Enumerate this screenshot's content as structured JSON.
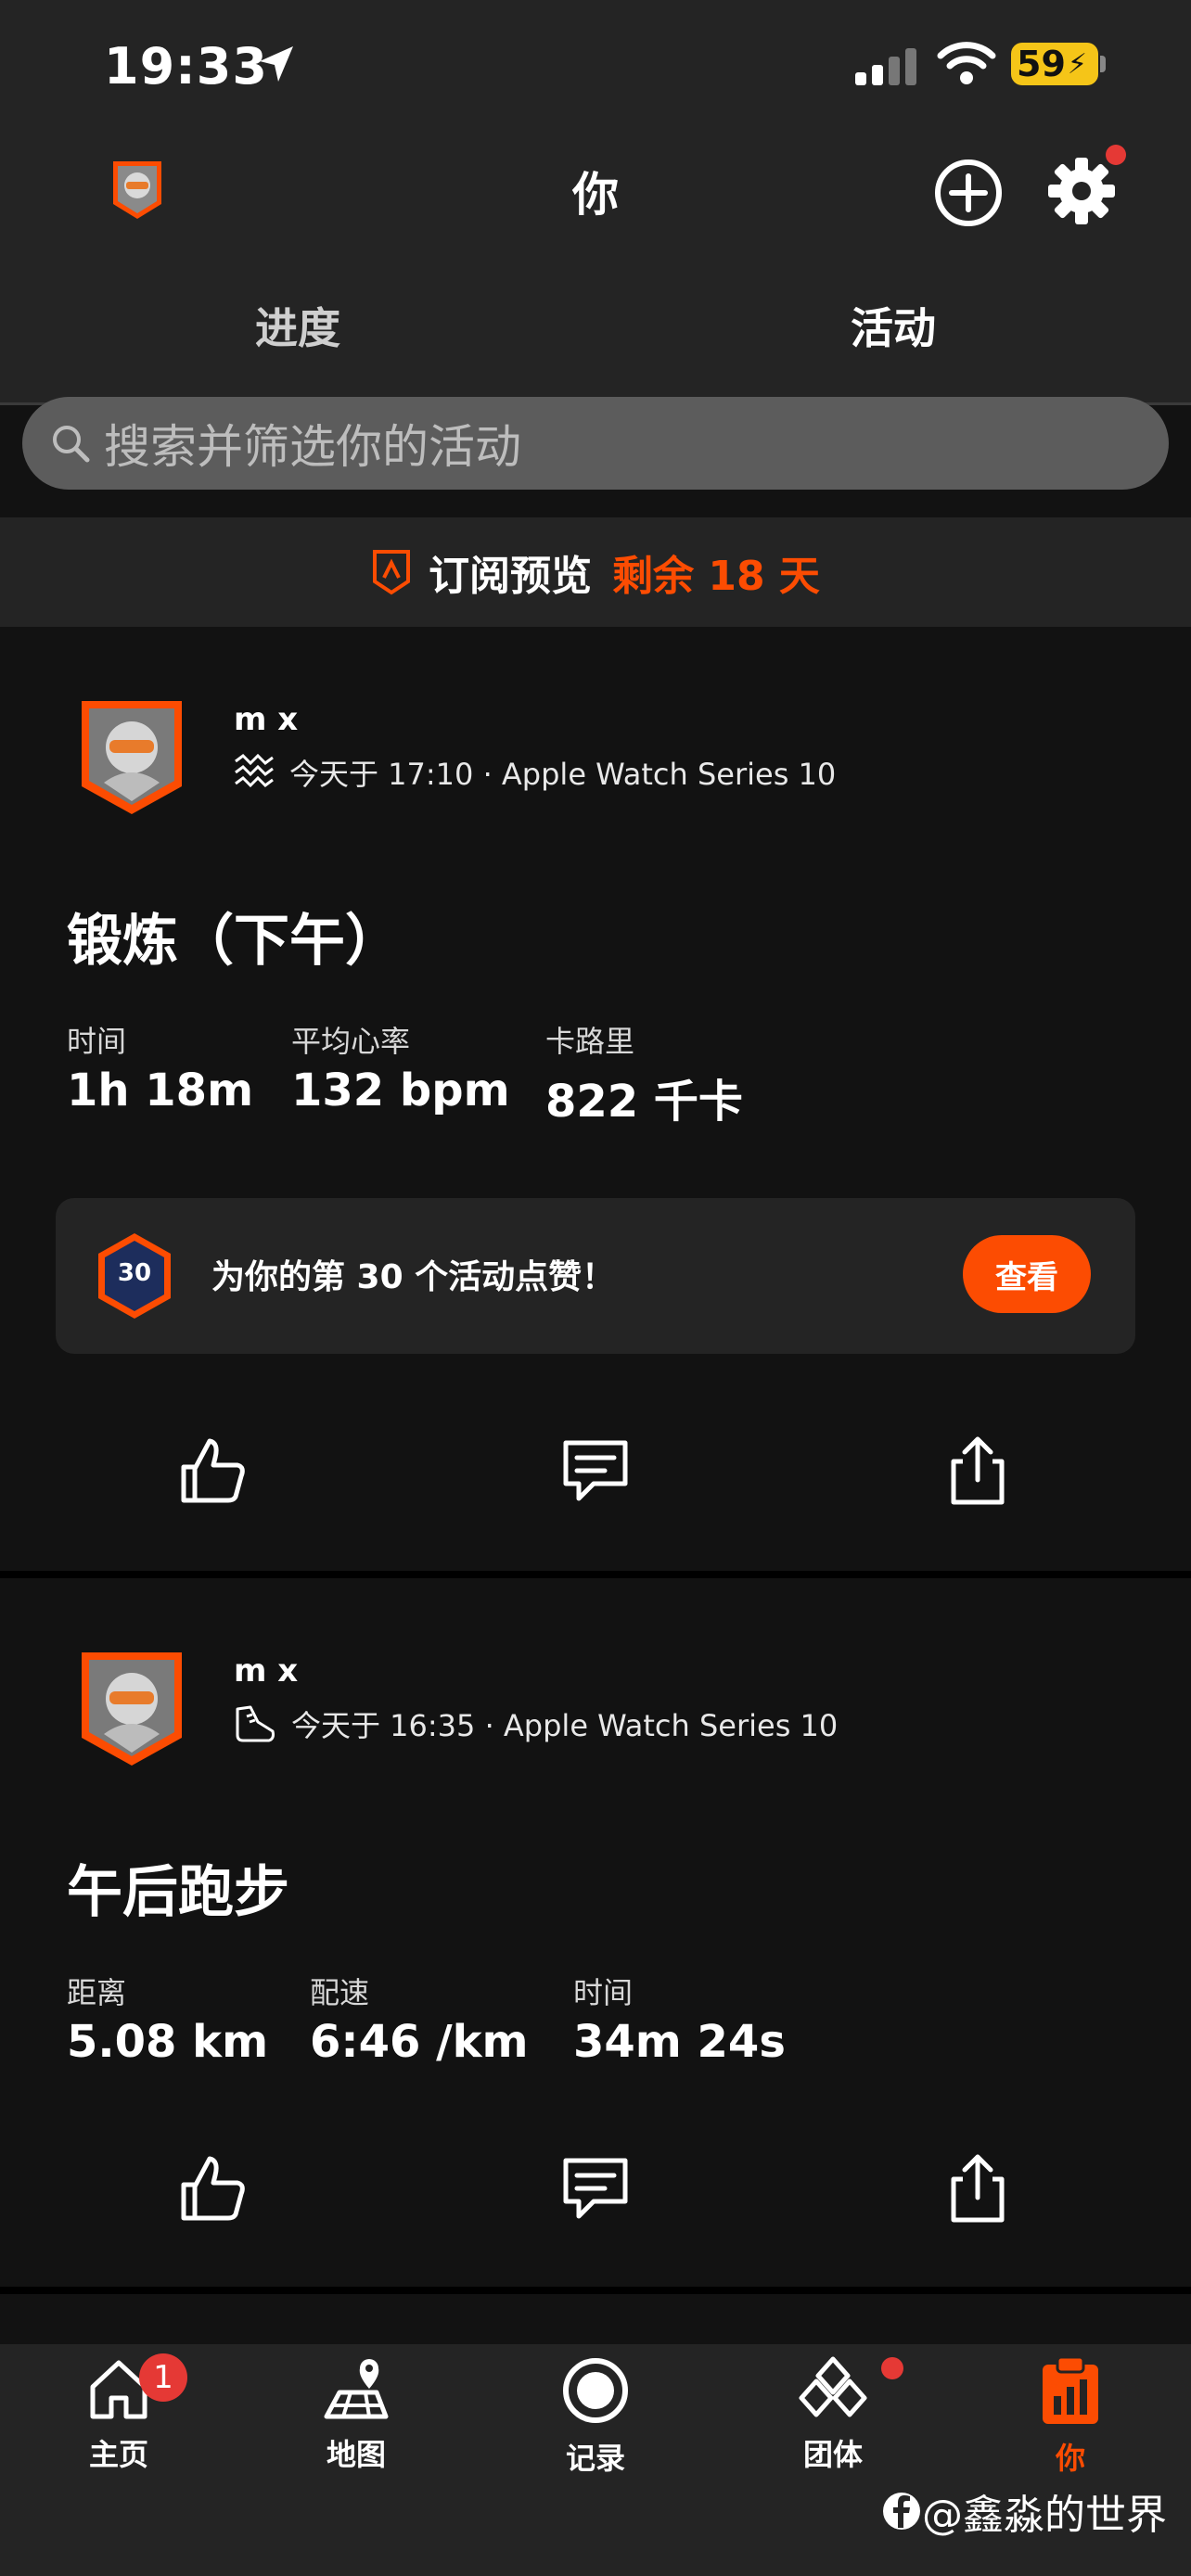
{
  "status_bar": {
    "time": "19:33",
    "battery": "59"
  },
  "header": {
    "title": "你"
  },
  "tabs": [
    {
      "label": "进度",
      "active": false
    },
    {
      "label": "活动",
      "active": true
    }
  ],
  "search": {
    "placeholder": "搜索并筛选你的活动"
  },
  "subscription": {
    "label": "订阅预览",
    "remaining": "剩余 18 天"
  },
  "activities": [
    {
      "user": "m x",
      "meta": "今天于 17:10 · Apple Watch Series 10",
      "sport_icon": "workout-icon",
      "title": "锻炼（下午）",
      "stats": [
        {
          "label": "时间",
          "value": "1h 18m"
        },
        {
          "label": "平均心率",
          "value": "132 bpm"
        },
        {
          "label": "卡路里",
          "value": "822 千卡"
        }
      ],
      "milestone": {
        "badge": "30",
        "text": "为你的第 30 个活动点赞！",
        "button": "查看"
      }
    },
    {
      "user": "m x",
      "meta": "今天于 16:35 · Apple Watch Series 10",
      "sport_icon": "shoe-icon",
      "title": "午后跑步",
      "stats": [
        {
          "label": "距离",
          "value": "5.08 km"
        },
        {
          "label": "配速",
          "value": "6:46 /km"
        },
        {
          "label": "时间",
          "value": "34m 24s"
        }
      ]
    }
  ],
  "bottom_nav": [
    {
      "label": "主页",
      "icon": "home-icon",
      "badge": "1"
    },
    {
      "label": "地图",
      "icon": "map-icon"
    },
    {
      "label": "记录",
      "icon": "record-icon"
    },
    {
      "label": "团体",
      "icon": "groups-icon",
      "dot": true
    },
    {
      "label": "你",
      "icon": "you-icon",
      "active": true
    }
  ],
  "watermark": "@鑫淼的世界",
  "colors": {
    "accent": "#fc4c02",
    "background": "#121212",
    "surface": "#242424",
    "alert": "#e53935"
  }
}
